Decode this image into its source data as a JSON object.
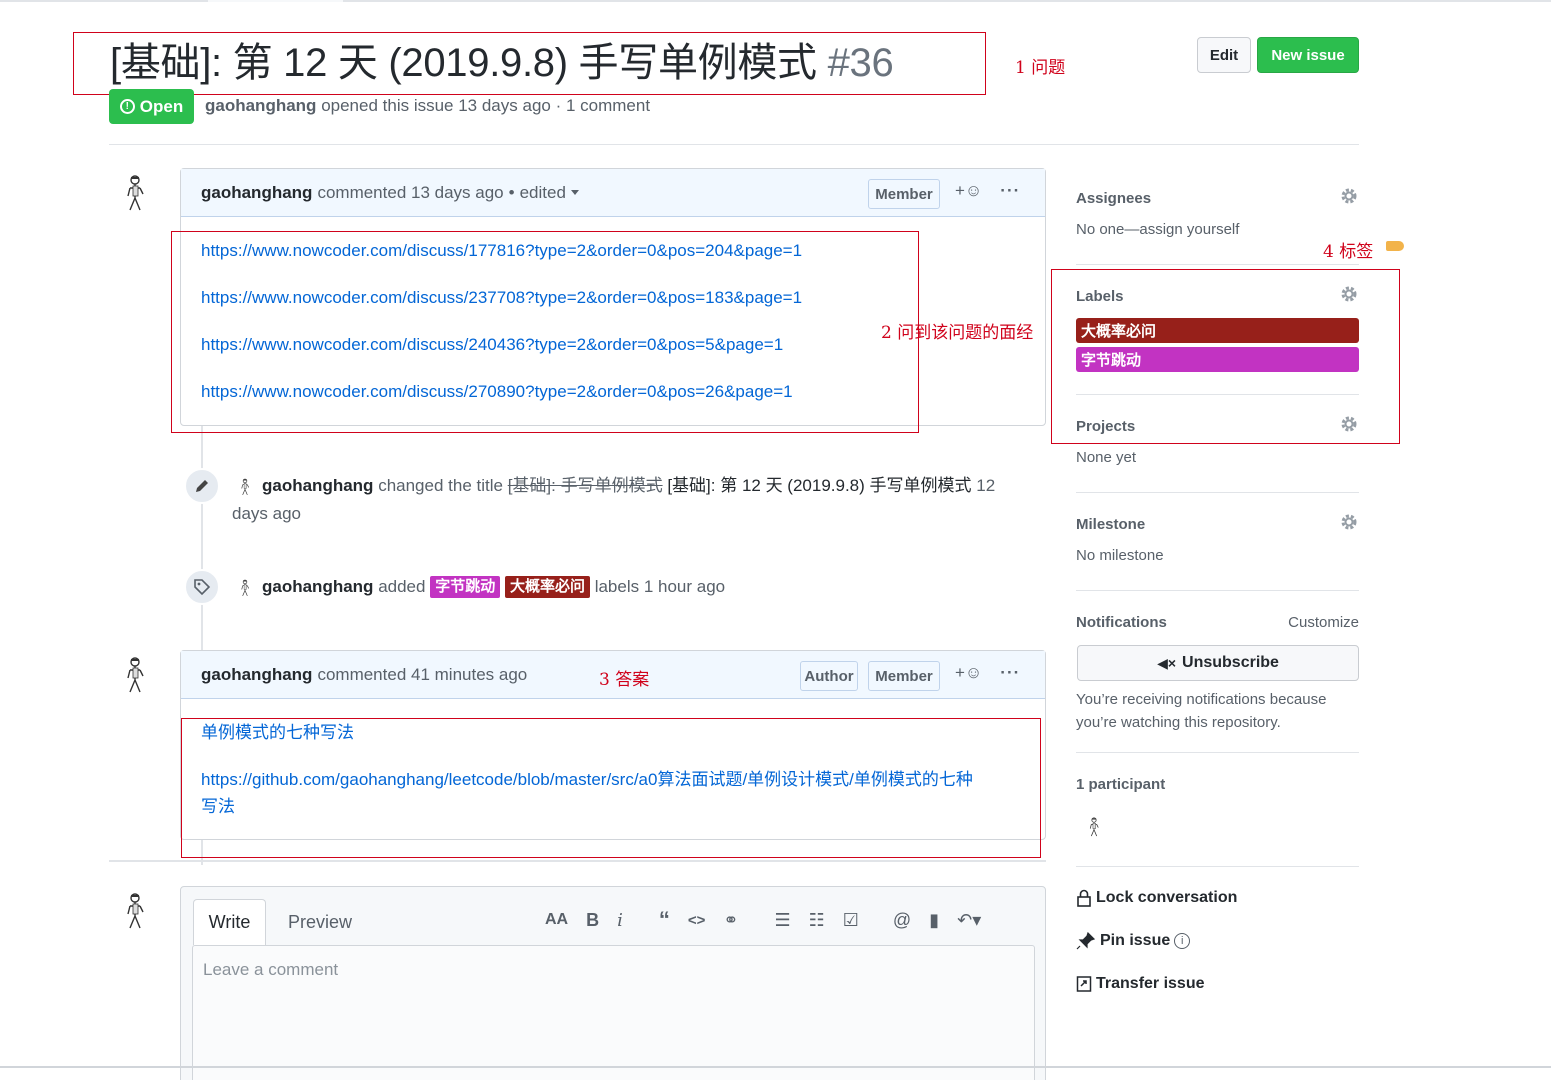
{
  "issue": {
    "title": "[基础]: 第 12 天 (2019.9.8) 手写单例模式",
    "number": "#36",
    "state": "Open",
    "author": "gaohanghang",
    "meta_rest": "opened this issue 13 days ago · 1 comment"
  },
  "header_buttons": {
    "edit": "Edit",
    "new_issue": "New issue"
  },
  "annotations": {
    "a1": "1 问题",
    "a2": "2 问到该问题的面经",
    "a3": "3 答案",
    "a4": "4 标签"
  },
  "comment1": {
    "author": "gaohanghang",
    "action": "commented 13 days ago",
    "edited": "edited",
    "role": "Member",
    "links": [
      "https://www.nowcoder.com/discuss/177816?type=2&order=0&pos=204&page=1",
      "https://www.nowcoder.com/discuss/237708?type=2&order=0&pos=183&page=1",
      "https://www.nowcoder.com/discuss/240436?type=2&order=0&pos=5&page=1",
      "https://www.nowcoder.com/discuss/270890?type=2&order=0&pos=26&page=1"
    ]
  },
  "event_rename": {
    "author": "gaohanghang",
    "action": "changed the title",
    "old_title": "[基础]: 手写单例模式",
    "new_title": "[基础]: 第 12 天 (2019.9.8) 手写单例模式",
    "when": "12 days ago"
  },
  "event_labels": {
    "author": "gaohanghang",
    "action": "added",
    "label1": "字节跳动",
    "label2": "大概率必问",
    "suffix": "labels 1 hour ago"
  },
  "comment2": {
    "author": "gaohanghang",
    "action": "commented 41 minutes ago",
    "role_author": "Author",
    "role_member": "Member",
    "link_title": "单例模式的七种写法",
    "link_url_line1": "https://github.com/gaohanghang/leetcode/blob/master/src/a0算法面试题/单例设计模式/单例模式的七种",
    "link_url_line2": "写法"
  },
  "sidebar": {
    "assignees_title": "Assignees",
    "assignees_value": "No one—assign yourself",
    "labels_title": "Labels",
    "labels": [
      {
        "name": "大概率必问",
        "color": "#97201a"
      },
      {
        "name": "字节跳动",
        "color": "#c233c2"
      }
    ],
    "projects_title": "Projects",
    "projects_value": "None yet",
    "milestone_title": "Milestone",
    "milestone_value": "No milestone",
    "notifications_title": "Notifications",
    "customize": "Customize",
    "unsubscribe": "Unsubscribe",
    "notif_reason_1": "You’re receiving notifications because",
    "notif_reason_2": "you’re watching this repository.",
    "participants": "1 participant",
    "lock": "Lock conversation",
    "pin": "Pin issue",
    "transfer": "Transfer issue"
  },
  "editor": {
    "tab_write": "Write",
    "tab_preview": "Preview",
    "placeholder": "Leave a comment",
    "tools": {
      "heading": "AA",
      "bold": "B",
      "italic": "i",
      "mention": "@"
    }
  },
  "colors": {
    "accent_green": "#2cbe4e",
    "link_blue": "#0366d6",
    "annotation_red": "#d0021b"
  }
}
